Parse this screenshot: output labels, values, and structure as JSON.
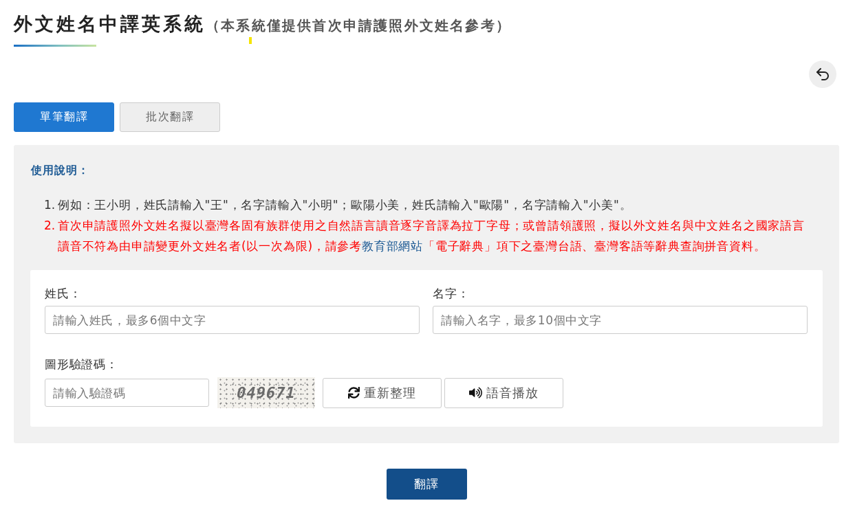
{
  "header": {
    "title": "外文姓名中譯英系統",
    "subtitle": "（本系統僅提供首次申請護照外文姓名參考）"
  },
  "tabs": [
    {
      "label": "單筆翻譯",
      "selected": true
    },
    {
      "label": "批次翻譯",
      "selected": false
    }
  ],
  "instructions": {
    "heading": "使用說明：",
    "items": [
      {
        "number": "1.",
        "kind": "note",
        "text": "例如：王小明，姓氏請輸入\"王\"，名字請輸入\"小明\"；歐陽小美，姓氏請輸入\"歐陽\"，名字請輸入\"小美\"。"
      },
      {
        "number": "2.",
        "kind": "warning",
        "text": "首次申請護照外文姓名擬以臺灣各固有族群使用之自然語言讀音逐字音譯為拉丁字母；或曾請領護照，擬以外文姓名與中文姓名之國家語言讀音不符為由申請變更外文姓名者(以一次為限)，請參考",
        "link": "教育部網站",
        "text_after": "「電子辭典」項下之臺灣台語、臺灣客語等辭典查詢拼音資料。"
      }
    ]
  },
  "form": {
    "fields": [
      {
        "label": "姓氏：",
        "placeholder": "請輸入姓氏，最多6個中文字"
      },
      {
        "label": "名字：",
        "placeholder": "請輸入名字，最多10個中文字"
      }
    ],
    "captcha": {
      "label": "圖形驗證碼：",
      "placeholder": "請輸入驗證碼",
      "code": "049671",
      "buttons": [
        {
          "kind": "refresh",
          "label": "重新整理"
        },
        {
          "kind": "audio",
          "label": "語音播放"
        }
      ]
    }
  },
  "submit": {
    "label": "翻譯"
  }
}
